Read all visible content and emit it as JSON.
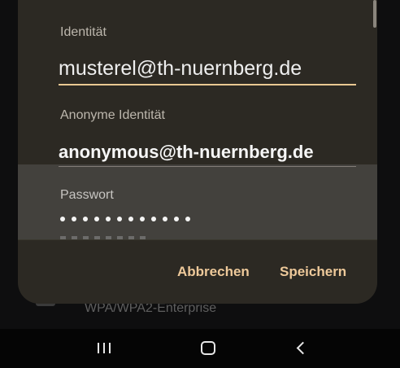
{
  "background": {
    "network_item_subtitle": "WPA/WPA2-Enterprise"
  },
  "dialog": {
    "fields": {
      "identity": {
        "label": "Identität",
        "value": "musterel@th-nuernberg.de"
      },
      "anonymous_identity": {
        "label": "Anonyme Identität",
        "value": "anonymous@th-nuernberg.de"
      },
      "password": {
        "label": "Passwort",
        "masked_length": 12
      }
    },
    "buttons": {
      "cancel": "Abbrechen",
      "save": "Speichern"
    }
  },
  "navbar": {
    "icons": [
      "recents-icon",
      "home-icon",
      "back-icon"
    ]
  },
  "colors": {
    "dialog_bg": "#2c2923",
    "accent": "#eec99a",
    "focused_underline": "#e9c892"
  }
}
